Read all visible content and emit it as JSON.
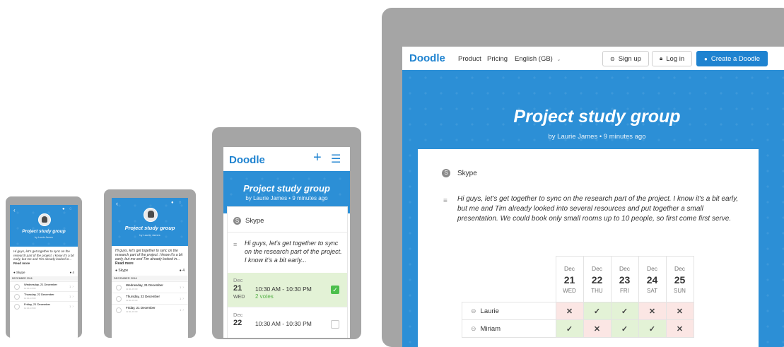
{
  "brand": "Doodle",
  "poll": {
    "title": "Project study group",
    "byline": "by Laurie James • 9 minutes ago",
    "byline_short": "by Laurie James",
    "location": "Skype",
    "description_full": "Hi guys, let's get together to sync on the research part of the project. I know it's a bit early, but me and Tim already looked into several resources and put together a small presentation. We could book only small rooms up to 10 people, so first come first serve.",
    "description_mobile": "Hi guys, let's get together to sync on the research part of the project. I know it's a bit early...",
    "description_tiny": "Hi guys, let's get together to sync on the research part of the project. I know it's a bit early, but me and Tim already looked in...",
    "read_more": "Read more",
    "participant_count": "4",
    "month_header": "DECEMBER 2016"
  },
  "desktop_nav": {
    "product": "Product",
    "pricing": "Pricing",
    "language": "English (GB)",
    "signup": "Sign up",
    "login": "Log in",
    "create": "Create a Doodle"
  },
  "desktop_table": {
    "dates": [
      {
        "month": "Dec",
        "day": "21",
        "weekday": "WED"
      },
      {
        "month": "Dec",
        "day": "22",
        "weekday": "THU"
      },
      {
        "month": "Dec",
        "day": "23",
        "weekday": "FRI"
      },
      {
        "month": "Dec",
        "day": "24",
        "weekday": "SAT"
      },
      {
        "month": "Dec",
        "day": "25",
        "weekday": "SUN"
      }
    ],
    "participants": [
      {
        "name": "Laurie",
        "votes": [
          "no",
          "yes",
          "yes",
          "no",
          "no"
        ]
      },
      {
        "name": "Miriam",
        "votes": [
          "yes",
          "no",
          "yes",
          "yes",
          "no"
        ]
      }
    ]
  },
  "mobile_list": {
    "options": [
      {
        "month": "Dec",
        "day": "21",
        "weekday": "WED",
        "time": "10:30 AM - 10:30 PM",
        "votes": "2 votes",
        "checked": true
      },
      {
        "month": "Dec",
        "day": "22",
        "weekday": "",
        "time": "10:30 AM - 10:30 PM",
        "votes": "",
        "checked": false
      }
    ]
  },
  "tiny_list": {
    "options": [
      {
        "label": "Wednesday, 21 December",
        "time": "11:40–15:00",
        "count": "1"
      },
      {
        "label": "Thursday, 22 December",
        "time": "11:40–15:00",
        "count": "1"
      },
      {
        "label": "Friday, 21 December",
        "time": "11:40–15:00",
        "count": "1"
      }
    ]
  },
  "colors": {
    "brand_blue": "#2c8fd6",
    "frame_gray": "#a5a5a5",
    "yes_green": "#58b24a",
    "no_red": "#f2a49d"
  }
}
